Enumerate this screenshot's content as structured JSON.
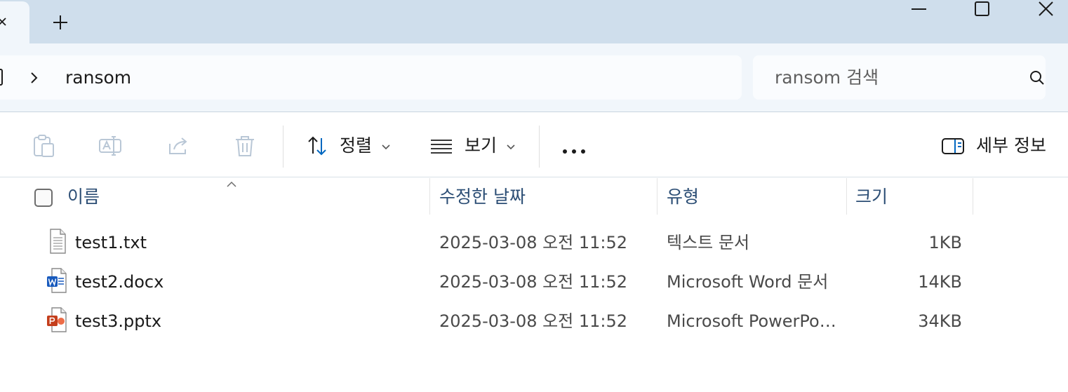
{
  "window": {
    "tab_close_glyph": "‹",
    "controls": [
      "minimize",
      "maximize",
      "close"
    ]
  },
  "address": {
    "path_segment": "ransom"
  },
  "search": {
    "placeholder": "ransom 검색"
  },
  "toolbar": {
    "sort_label": "정렬",
    "view_label": "보기",
    "details_label": "세부 정보",
    "accent": "#0067c0"
  },
  "columns": {
    "name": "이름",
    "modified": "수정한 날짜",
    "type": "유형",
    "size": "크기"
  },
  "files": [
    {
      "name": "test1.txt",
      "modified": "2025-03-08 오전 11:52",
      "type": "텍스트 문서",
      "size": "1KB",
      "icon": "text-file-icon"
    },
    {
      "name": "test2.docx",
      "modified": "2025-03-08 오전 11:52",
      "type": "Microsoft Word 문서",
      "size": "14KB",
      "icon": "word-file-icon"
    },
    {
      "name": "test3.pptx",
      "modified": "2025-03-08 오전 11:52",
      "type": "Microsoft PowerPoint 프레젠테이션",
      "size": "34KB",
      "icon": "powerpoint-file-icon"
    }
  ],
  "colors": {
    "titlebar": "#cfdeec",
    "address_row": "#f1f6fb",
    "header_text": "#2c4e75",
    "word_blue": "#185abd",
    "powerpoint_red": "#c43e1c"
  }
}
